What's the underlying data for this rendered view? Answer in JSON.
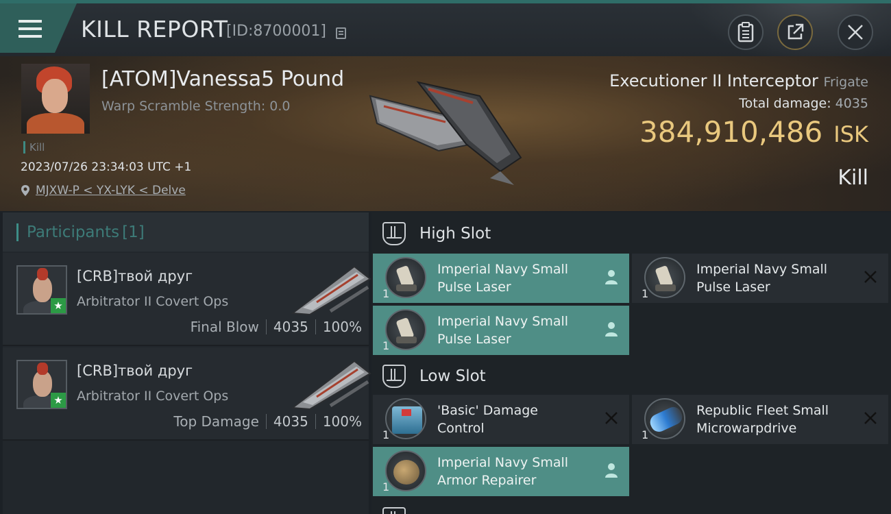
{
  "header": {
    "title": "KILL REPORT",
    "report_id": "[ID:8700001]",
    "icons": [
      "menu-icon",
      "copy-icon",
      "clipboard-icon",
      "share-icon",
      "close-icon"
    ]
  },
  "victim": {
    "name": "[ATOM]Vanessa5 Pound",
    "warp_scramble": "Warp Scramble Strength: 0.0",
    "tag": "Kill",
    "timestamp": "2023/07/26 23:34:03 UTC +1",
    "location": "MJXW-P < YX-LYK < Delve",
    "ship_name": "Executioner II Interceptor",
    "ship_class": "Frigate",
    "total_damage_label": "Total damage:",
    "total_damage": "4035",
    "isk_value": "384,910,486",
    "isk_unit": "ISK",
    "result": "Kill"
  },
  "participants": {
    "title": "Participants",
    "count": "[1]",
    "rows": [
      {
        "name": "[CRB]твой друг",
        "ship": "Arbitrator II Covert Ops",
        "role": "Final Blow",
        "damage": "4035",
        "percent": "100%"
      },
      {
        "name": "[CRB]твой друг",
        "ship": "Arbitrator II Covert Ops",
        "role": "Top Damage",
        "damage": "4035",
        "percent": "100%"
      }
    ]
  },
  "fittings": {
    "high_slot_label": "High Slot",
    "low_slot_label": "Low Slot",
    "high": [
      {
        "name_line1": "Imperial Navy Small",
        "name_line2": "Pulse Laser",
        "qty": "1",
        "status": "dropped"
      },
      {
        "name_line1": "Imperial Navy Small",
        "name_line2": "Pulse Laser",
        "qty": "1",
        "status": "destroyed"
      },
      {
        "name_line1": "Imperial Navy Small",
        "name_line2": "Pulse Laser",
        "qty": "1",
        "status": "dropped"
      }
    ],
    "low": [
      {
        "name_line1": "'Basic' Damage",
        "name_line2": "Control",
        "qty": "1",
        "status": "destroyed"
      },
      {
        "name_line1": "Republic Fleet Small",
        "name_line2": "Microwarpdrive",
        "qty": "1",
        "status": "destroyed"
      },
      {
        "name_line1": "Imperial Navy Small",
        "name_line2": "Armor Repairer",
        "qty": "1",
        "status": "dropped"
      }
    ]
  },
  "colors": {
    "accent": "#4f8e86",
    "isk": "#e9c87e"
  }
}
